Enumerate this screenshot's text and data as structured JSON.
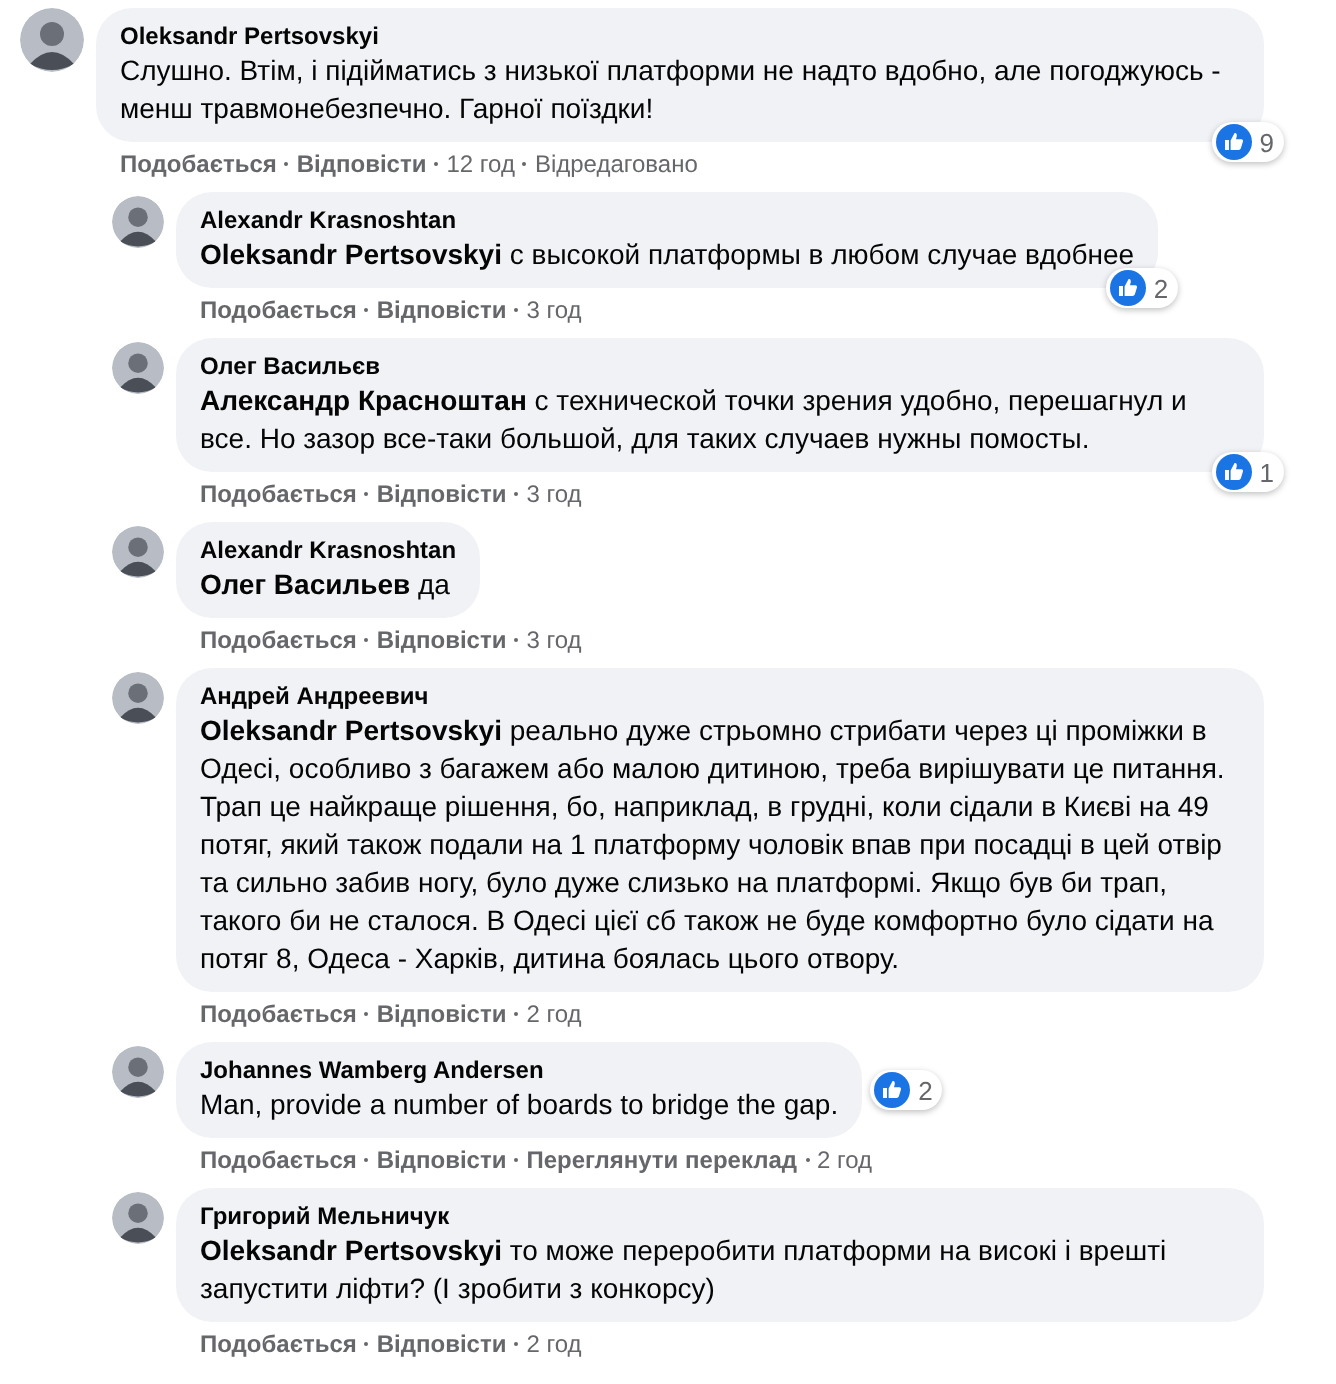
{
  "comments": [
    {
      "author": "Oleksandr Pertsovskyi",
      "text": "Слушно. Втім, і підійматись з низької платформи не надто вдобно, але погоджуюсь - менш травмонебезпечно. Гарної поїздки!",
      "reactions": {
        "count": "9"
      },
      "actions": [
        {
          "label": "Подобається",
          "kind": "link"
        },
        {
          "label": "Відповісти",
          "kind": "link"
        },
        {
          "label": "12 год",
          "kind": "time"
        },
        {
          "label": "Відредаговано",
          "kind": "note"
        }
      ],
      "replies": [
        {
          "author": "Alexandr Krasnoshtan",
          "text": "**Oleksandr Pertsovskyi** с высокой платформы в любом случае вдобнее",
          "reactions": {
            "count": "2"
          },
          "actions": [
            {
              "label": "Подобається",
              "kind": "link"
            },
            {
              "label": "Відповісти",
              "kind": "link"
            },
            {
              "label": "3 год",
              "kind": "time"
            }
          ]
        },
        {
          "author": "Олег Васильєв",
          "text": "**Александр Красноштан** с технической точки зрения удобно, перешагнул и все. Но зазор все-таки большой, для таких случаев нужны помосты.",
          "reactions": {
            "count": "1"
          },
          "actions": [
            {
              "label": "Подобається",
              "kind": "link"
            },
            {
              "label": "Відповісти",
              "kind": "link"
            },
            {
              "label": "3 год",
              "kind": "time"
            }
          ]
        },
        {
          "author": "Alexandr Krasnoshtan",
          "text": "**Олег Васильев** да",
          "actions": [
            {
              "label": "Подобається",
              "kind": "link"
            },
            {
              "label": "Відповісти",
              "kind": "link"
            },
            {
              "label": "3 год",
              "kind": "time"
            }
          ]
        },
        {
          "author": "Андрей Андреевич",
          "text": "**Oleksandr Pertsovskyi** реально дуже стрьомно стрибати через ці проміжки в Одесі, особливо з багажем або малою дитиною, треба вирішувати це питання. Трап це найкраще рішення, бо, наприклад, в грудні, коли сідали в Києві на 49 потяг, який також подали на 1 платформу чоловік впав при посадці в цей отвір та сильно забив ногу, було дуже слизько на платформі. Якщо був би трап, такого би не сталося. В Одесі цієї сб також не буде комфортно було сідати на потяг 8, Одеса - Харків, дитина боялась цього отвору.",
          "actions": [
            {
              "label": "Подобається",
              "kind": "link"
            },
            {
              "label": "Відповісти",
              "kind": "link"
            },
            {
              "label": "2 год",
              "kind": "time"
            }
          ]
        },
        {
          "author": "Johannes Wamberg Andersen",
          "text": "Man, provide a number of boards to bridge the gap.",
          "reactions": {
            "count": "2"
          },
          "actions": [
            {
              "label": "Подобається",
              "kind": "link"
            },
            {
              "label": "Відповісти",
              "kind": "link"
            },
            {
              "label": "Переглянути переклад",
              "kind": "link"
            },
            {
              "label": "2 год",
              "kind": "time"
            }
          ]
        },
        {
          "author": "Григорий Мельничук",
          "text": "**Oleksandr Pertsovskyi** то може переробити платформи на високі і врешті запустити ліфти? (І зробити з конкорсу)",
          "actions": [
            {
              "label": "Подобається",
              "kind": "link"
            },
            {
              "label": "Відповісти",
              "kind": "link"
            },
            {
              "label": "2 год",
              "kind": "time"
            }
          ]
        }
      ]
    }
  ]
}
